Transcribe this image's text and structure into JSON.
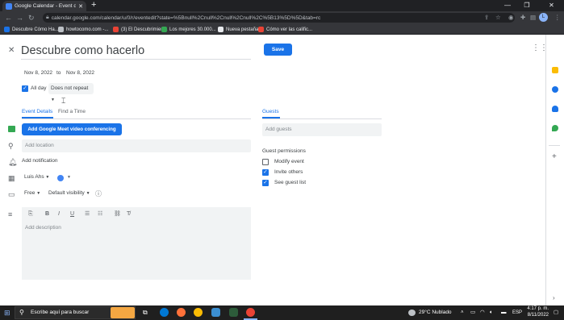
{
  "browser": {
    "tab_title": "Google Calendar - Event details",
    "new_tab": "+",
    "url": "calendar.google.com/calendar/u/0/r/eventedit?state=%5Bnull%2Cnull%2Cnull%2Cnull%2C%5B13%5D%5D&tab=rc",
    "bookmarks": [
      {
        "label": "Descubre Cómo Ha...",
        "color": "#1a73e8"
      },
      {
        "label": "howtocomo.com -...",
        "color": "#bdc1c6"
      },
      {
        "label": "(3) El Descubrimien...",
        "color": "#ea4335"
      },
      {
        "label": "Los mejores 30.000...",
        "color": "#34a853"
      },
      {
        "label": "Nueva pestaña",
        "color": "#e8eaed"
      },
      {
        "label": "Cómo ver las calific...",
        "color": "#ea4335"
      }
    ],
    "profile_initial": "L"
  },
  "event": {
    "title": "Descubre como hacerlo",
    "save_label": "Save",
    "start_date": "Nov 8, 2022",
    "to_label": "to",
    "end_date": "Nov 8, 2022",
    "all_day_label": "All day",
    "repeat_label": "Does not repeat",
    "tabs": [
      "Event Details",
      "Find a Time"
    ],
    "meet_button": "Add Google Meet video conferencing",
    "location_placeholder": "Add location",
    "notification_label": "Add notification",
    "calendar_owner": "Luis Ahs",
    "calendar_color": "#4285f4",
    "availability": "Free",
    "visibility": "Default visibility",
    "description_placeholder": "Add description"
  },
  "guests": {
    "heading": "Guests",
    "add_placeholder": "Add guests",
    "permissions_heading": "Guest permissions",
    "permissions": [
      {
        "label": "Modify event",
        "checked": false
      },
      {
        "label": "Invite others",
        "checked": true
      },
      {
        "label": "See guest list",
        "checked": true
      }
    ]
  },
  "header": {
    "account_initial": "L"
  },
  "taskbar": {
    "search_placeholder": "Escribe aquí para buscar",
    "weather": "29°C Nublado",
    "lang": "ESP",
    "time": "4:17 p. m.",
    "date": "8/11/2022"
  },
  "colors": {
    "accent": "#1a73e8",
    "chrome_dark": "#202124"
  }
}
